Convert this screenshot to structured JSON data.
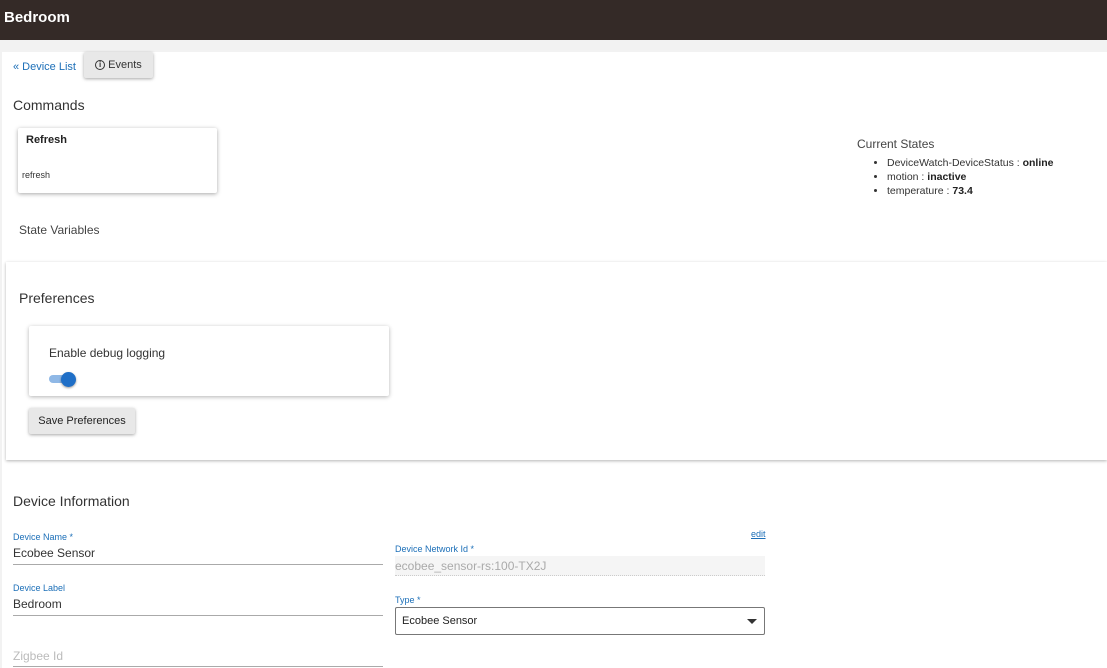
{
  "header": {
    "title": "Bedroom"
  },
  "nav": {
    "back_link": "« Device List",
    "events_button": "Events",
    "events_icon": "info-icon"
  },
  "commands": {
    "title": "Commands",
    "items": [
      {
        "name": "Refresh",
        "command": "refresh"
      }
    ]
  },
  "current_states": {
    "title": "Current States",
    "items": [
      {
        "name": "DeviceWatch-DeviceStatus :",
        "value": "online"
      },
      {
        "name": "motion :",
        "value": "inactive"
      },
      {
        "name": "temperature :",
        "value": "73.4"
      }
    ]
  },
  "state_variables": {
    "title": "State Variables"
  },
  "preferences": {
    "title": "Preferences",
    "debug_logging": {
      "label": "Enable debug logging",
      "enabled": true
    },
    "save_button": "Save Preferences"
  },
  "device_info": {
    "title": "Device Information",
    "device_name": {
      "label": "Device Name *",
      "value": "Ecobee Sensor"
    },
    "device_label": {
      "label": "Device Label",
      "value": "Bedroom"
    },
    "zigbee_id": {
      "placeholder": "Zigbee Id"
    },
    "edit_link": "edit",
    "network_id": {
      "label": "Device Network Id *",
      "value": "ecobee_sensor-rs:100-TX2J"
    },
    "type": {
      "label": "Type *",
      "value": "Ecobee Sensor"
    }
  },
  "colors": {
    "header_bg": "#342a27",
    "link": "#1c6fb8",
    "toggle_on": "#1f6fc7"
  }
}
